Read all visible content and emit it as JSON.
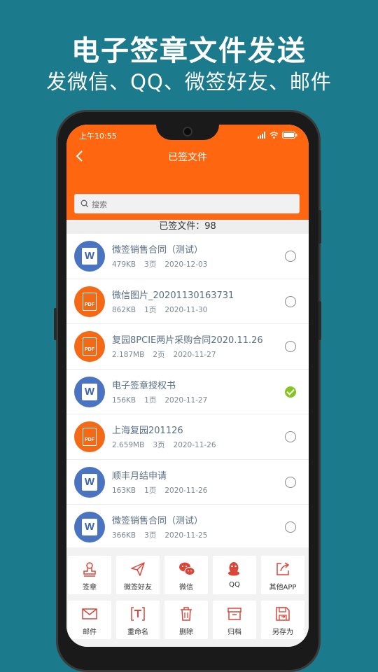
{
  "promo": {
    "headline": "电子签章文件发送",
    "subline": "发微信、QQ、微签好友、邮件"
  },
  "status_bar": {
    "time": "上午10:55"
  },
  "header": {
    "title": "已签文件"
  },
  "search": {
    "placeholder": "搜索"
  },
  "summary": {
    "count_text": "已签文件：98"
  },
  "files": [
    {
      "name": "微签销售合同（测试）",
      "size": "479KB",
      "pages": "3页",
      "date": "2020-12-03",
      "type": "word",
      "selected": false
    },
    {
      "name": "微信图片_20201130163731",
      "size": "862KB",
      "pages": "1页",
      "date": "2020-11-30",
      "type": "pdf",
      "selected": false
    },
    {
      "name": "复园8PCIE两片采购合同2020.11.26",
      "size": "2.187MB",
      "pages": "2页",
      "date": "2020-11-27",
      "type": "pdf",
      "selected": false
    },
    {
      "name": "电子签章授权书",
      "size": "156KB",
      "pages": "1页",
      "date": "2020-11-27",
      "type": "word",
      "selected": true
    },
    {
      "name": "上海复园201126",
      "size": "2.659MB",
      "pages": "3页",
      "date": "2020-11-26",
      "type": "pdf",
      "selected": false
    },
    {
      "name": "顺丰月结申请",
      "size": "163KB",
      "pages": "1页",
      "date": "2020-11-26",
      "type": "word",
      "selected": false
    },
    {
      "name": "微签销售合同（测试）",
      "size": "366KB",
      "pages": "3页",
      "date": "2020-11-25",
      "type": "word",
      "selected": false
    }
  ],
  "file_icon_labels": {
    "word": "W",
    "pdf": "PDF"
  },
  "actions_row1": [
    {
      "label": "签章",
      "icon": "stamp-icon"
    },
    {
      "label": "微签好友",
      "icon": "send-plane-icon"
    },
    {
      "label": "微信",
      "icon": "wechat-icon"
    },
    {
      "label": "QQ",
      "icon": "qq-penguin-icon"
    },
    {
      "label": "其他APP",
      "icon": "share-out-icon"
    }
  ],
  "actions_row2": [
    {
      "label": "邮件",
      "icon": "mail-icon"
    },
    {
      "label": "重命名",
      "icon": "rename-icon"
    },
    {
      "label": "删除",
      "icon": "trash-icon"
    },
    {
      "label": "归档",
      "icon": "archive-icon"
    },
    {
      "label": "另存为",
      "icon": "save-as-icon"
    }
  ],
  "colors": {
    "background": "#1b7a8c",
    "header": "#ff6610",
    "word_icon": "#4a74c2",
    "pdf_icon": "#f26a18",
    "action_icon": "#d9473a",
    "check": "#86c41f"
  }
}
